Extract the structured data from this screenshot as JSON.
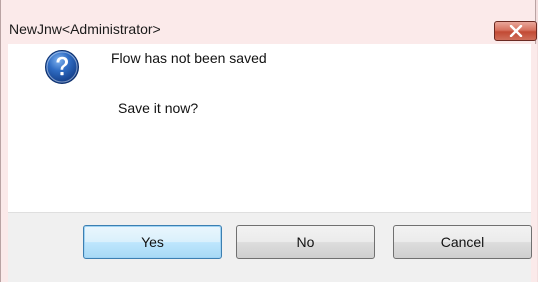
{
  "window": {
    "title": "NewJnw<Administrator>",
    "close_icon": "close-x-icon"
  },
  "message": {
    "icon": "question-icon",
    "line1": "Flow has not been saved",
    "line2": "Save it now?"
  },
  "buttons": {
    "yes": "Yes",
    "no": "No",
    "cancel": "Cancel"
  },
  "colors": {
    "close_button": "#c9503a",
    "question_icon": "#1e4f9c",
    "default_button_border": "#3c7fb1"
  }
}
